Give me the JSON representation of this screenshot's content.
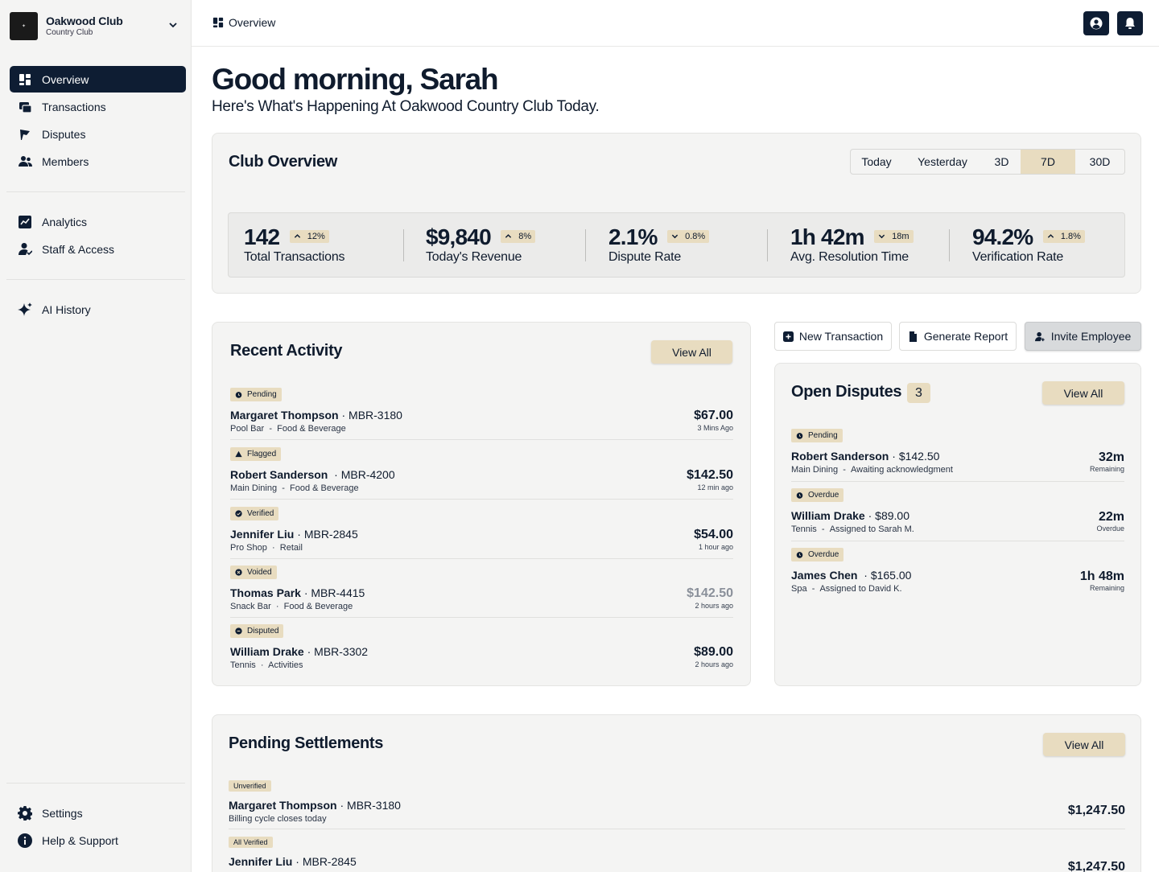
{
  "club": {
    "name": "Oakwood Club",
    "subtitle": "Country Club"
  },
  "nav": {
    "primary": [
      {
        "label": "Overview",
        "icon": "dashboard-icon",
        "active": true
      },
      {
        "label": "Transactions",
        "icon": "transactions-icon"
      },
      {
        "label": "Disputes",
        "icon": "flag-icon"
      },
      {
        "label": "Members",
        "icon": "members-icon"
      }
    ],
    "secondary": [
      {
        "label": "Analytics",
        "icon": "analytics-icon"
      },
      {
        "label": "Staff & Access",
        "icon": "staff-icon"
      }
    ],
    "tertiary": [
      {
        "label": "AI History",
        "icon": "sparkle-icon"
      }
    ],
    "footer": [
      {
        "label": "Settings",
        "icon": "gear-icon"
      },
      {
        "label": "Help & Support",
        "icon": "info-icon"
      }
    ]
  },
  "topbar": {
    "breadcrumb": "Overview"
  },
  "greeting": {
    "title": "Good morning, Sarah",
    "subtitle": "Here's What's Happening At Oakwood Country Club Today."
  },
  "overview": {
    "title": "Club Overview",
    "ranges": [
      "Today",
      "Yesterday",
      "3D",
      "7D",
      "30D"
    ],
    "selected_range": "7D",
    "stats": [
      {
        "value": "142",
        "delta": "12%",
        "direction": "up",
        "label": "Total Transactions"
      },
      {
        "value": "$9,840",
        "delta": "8%",
        "direction": "up",
        "label": "Today's Revenue"
      },
      {
        "value": "2.1%",
        "delta": "0.8%",
        "direction": "down",
        "label": "Dispute Rate"
      },
      {
        "value": "1h 42m",
        "delta": "18m",
        "direction": "down",
        "label": "Avg. Resolution Time"
      },
      {
        "value": "94.2%",
        "delta": "1.8%",
        "direction": "up",
        "label": "Verification Rate"
      }
    ]
  },
  "recent": {
    "title": "Recent Activity",
    "view_all": "View All",
    "items": [
      {
        "status": "Pending",
        "name": "Margaret Thompson",
        "id": "MBR-3180",
        "location": "Pool Bar",
        "sep": "-",
        "category": "Food & Beverage",
        "amount": "$67.00",
        "time": "3 Mins Ago"
      },
      {
        "status": "Flagged",
        "name": "Robert Sanderson",
        "id": "MBR-4200",
        "location": "Main Dining",
        "sep": "-",
        "category": "Food & Beverage",
        "amount": "$142.50",
        "time": "12 min ago"
      },
      {
        "status": "Verified",
        "name": "Jennifer Liu",
        "id": "MBR-2845",
        "location": "Pro Shop",
        "sep": "·",
        "category": "Retail",
        "amount": "$54.00",
        "time": "1 hour ago"
      },
      {
        "status": "Voided",
        "name": "Thomas Park",
        "id": "MBR-4415",
        "location": "Snack Bar",
        "sep": "·",
        "category": "Food & Beverage",
        "amount": "$142.50",
        "time": "2 hours ago"
      },
      {
        "status": "Disputed",
        "name": "William Drake",
        "id": "MBR-3302",
        "location": "Tennis",
        "sep": "·",
        "category": "Activities",
        "amount": "$89.00",
        "time": "2 hours ago"
      }
    ]
  },
  "actions": {
    "new_transaction": "New Transaction",
    "generate_report": "Generate Report",
    "invite_employee": "Invite Employee"
  },
  "disputes": {
    "title": "Open Disputes",
    "count": "3",
    "view_all": "View All",
    "items": [
      {
        "status": "Pending",
        "name": "Robert Sanderson",
        "amount": "$142.50",
        "location": "Main Dining",
        "note": "Awaiting acknowledgment",
        "time": "32m",
        "time_label": "Remaining"
      },
      {
        "status": "Overdue",
        "name": "William Drake",
        "amount": "$89.00",
        "location": "Tennis",
        "note": "Assigned to Sarah M.",
        "time": "22m",
        "time_label": "Overdue"
      },
      {
        "status": "Overdue",
        "name": "James Chen",
        "amount": "$165.00",
        "location": "Spa",
        "note": "Assigned to David K.",
        "time": "1h 48m",
        "time_label": "Remaining"
      }
    ]
  },
  "settlements": {
    "title": "Pending Settlements",
    "view_all": "View All",
    "items": [
      {
        "status": "Unverified",
        "name": "Margaret Thompson",
        "id": "MBR-3180",
        "note": "Billing cycle closes today",
        "amount": "$1,247.50"
      },
      {
        "status": "All Verified",
        "name": "Jennifer Liu",
        "id": "MBR-2845",
        "note": "",
        "amount": "$1,247.50"
      }
    ]
  },
  "colors": {
    "navy": "#0e1d33",
    "tan": "#e8dcc0",
    "panel": "#f4f4f3"
  }
}
